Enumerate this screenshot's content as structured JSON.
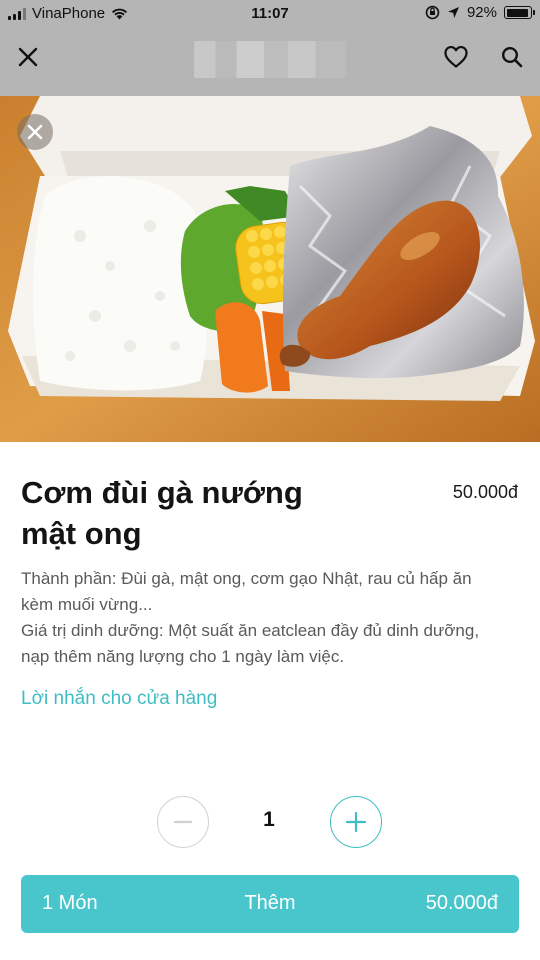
{
  "status_bar": {
    "carrier": "VinaPhone",
    "time": "11:07",
    "battery": "92%",
    "battery_level": 0.92,
    "icons": [
      "signal-icon",
      "wifi-icon",
      "orientation-lock-icon",
      "location-arrow-icon",
      "battery-icon"
    ]
  },
  "nav": {
    "close_icon": "close-icon",
    "favorite_icon": "heart-icon",
    "search_icon": "search-icon"
  },
  "photo": {
    "close_icon": "close-icon"
  },
  "product": {
    "title": "Cơm đùi gà nướng mật ong",
    "price": "50.000đ",
    "description": [
      "Thành phần: Đùi gà, mật ong, cơm gạo Nhật, rau củ hấp ăn",
      "kèm muối vừng...",
      "Giá trị dinh dưỡng: Một suất ăn eatclean đầy đủ dinh dưỡng,",
      "nạp thêm năng lượng cho 1 ngày làm việc."
    ],
    "note_link": "Lời nhắn cho cửa hàng"
  },
  "quantity": {
    "value": "1",
    "minus_icon": "minus-icon",
    "plus_icon": "plus-icon"
  },
  "add_to_cart": {
    "count": "1 Món",
    "label": "Thêm",
    "total": "50.000đ"
  },
  "colors": {
    "accent": "#49c6cc",
    "link": "#3fbdc4",
    "overlay": "#b5b5b5"
  }
}
